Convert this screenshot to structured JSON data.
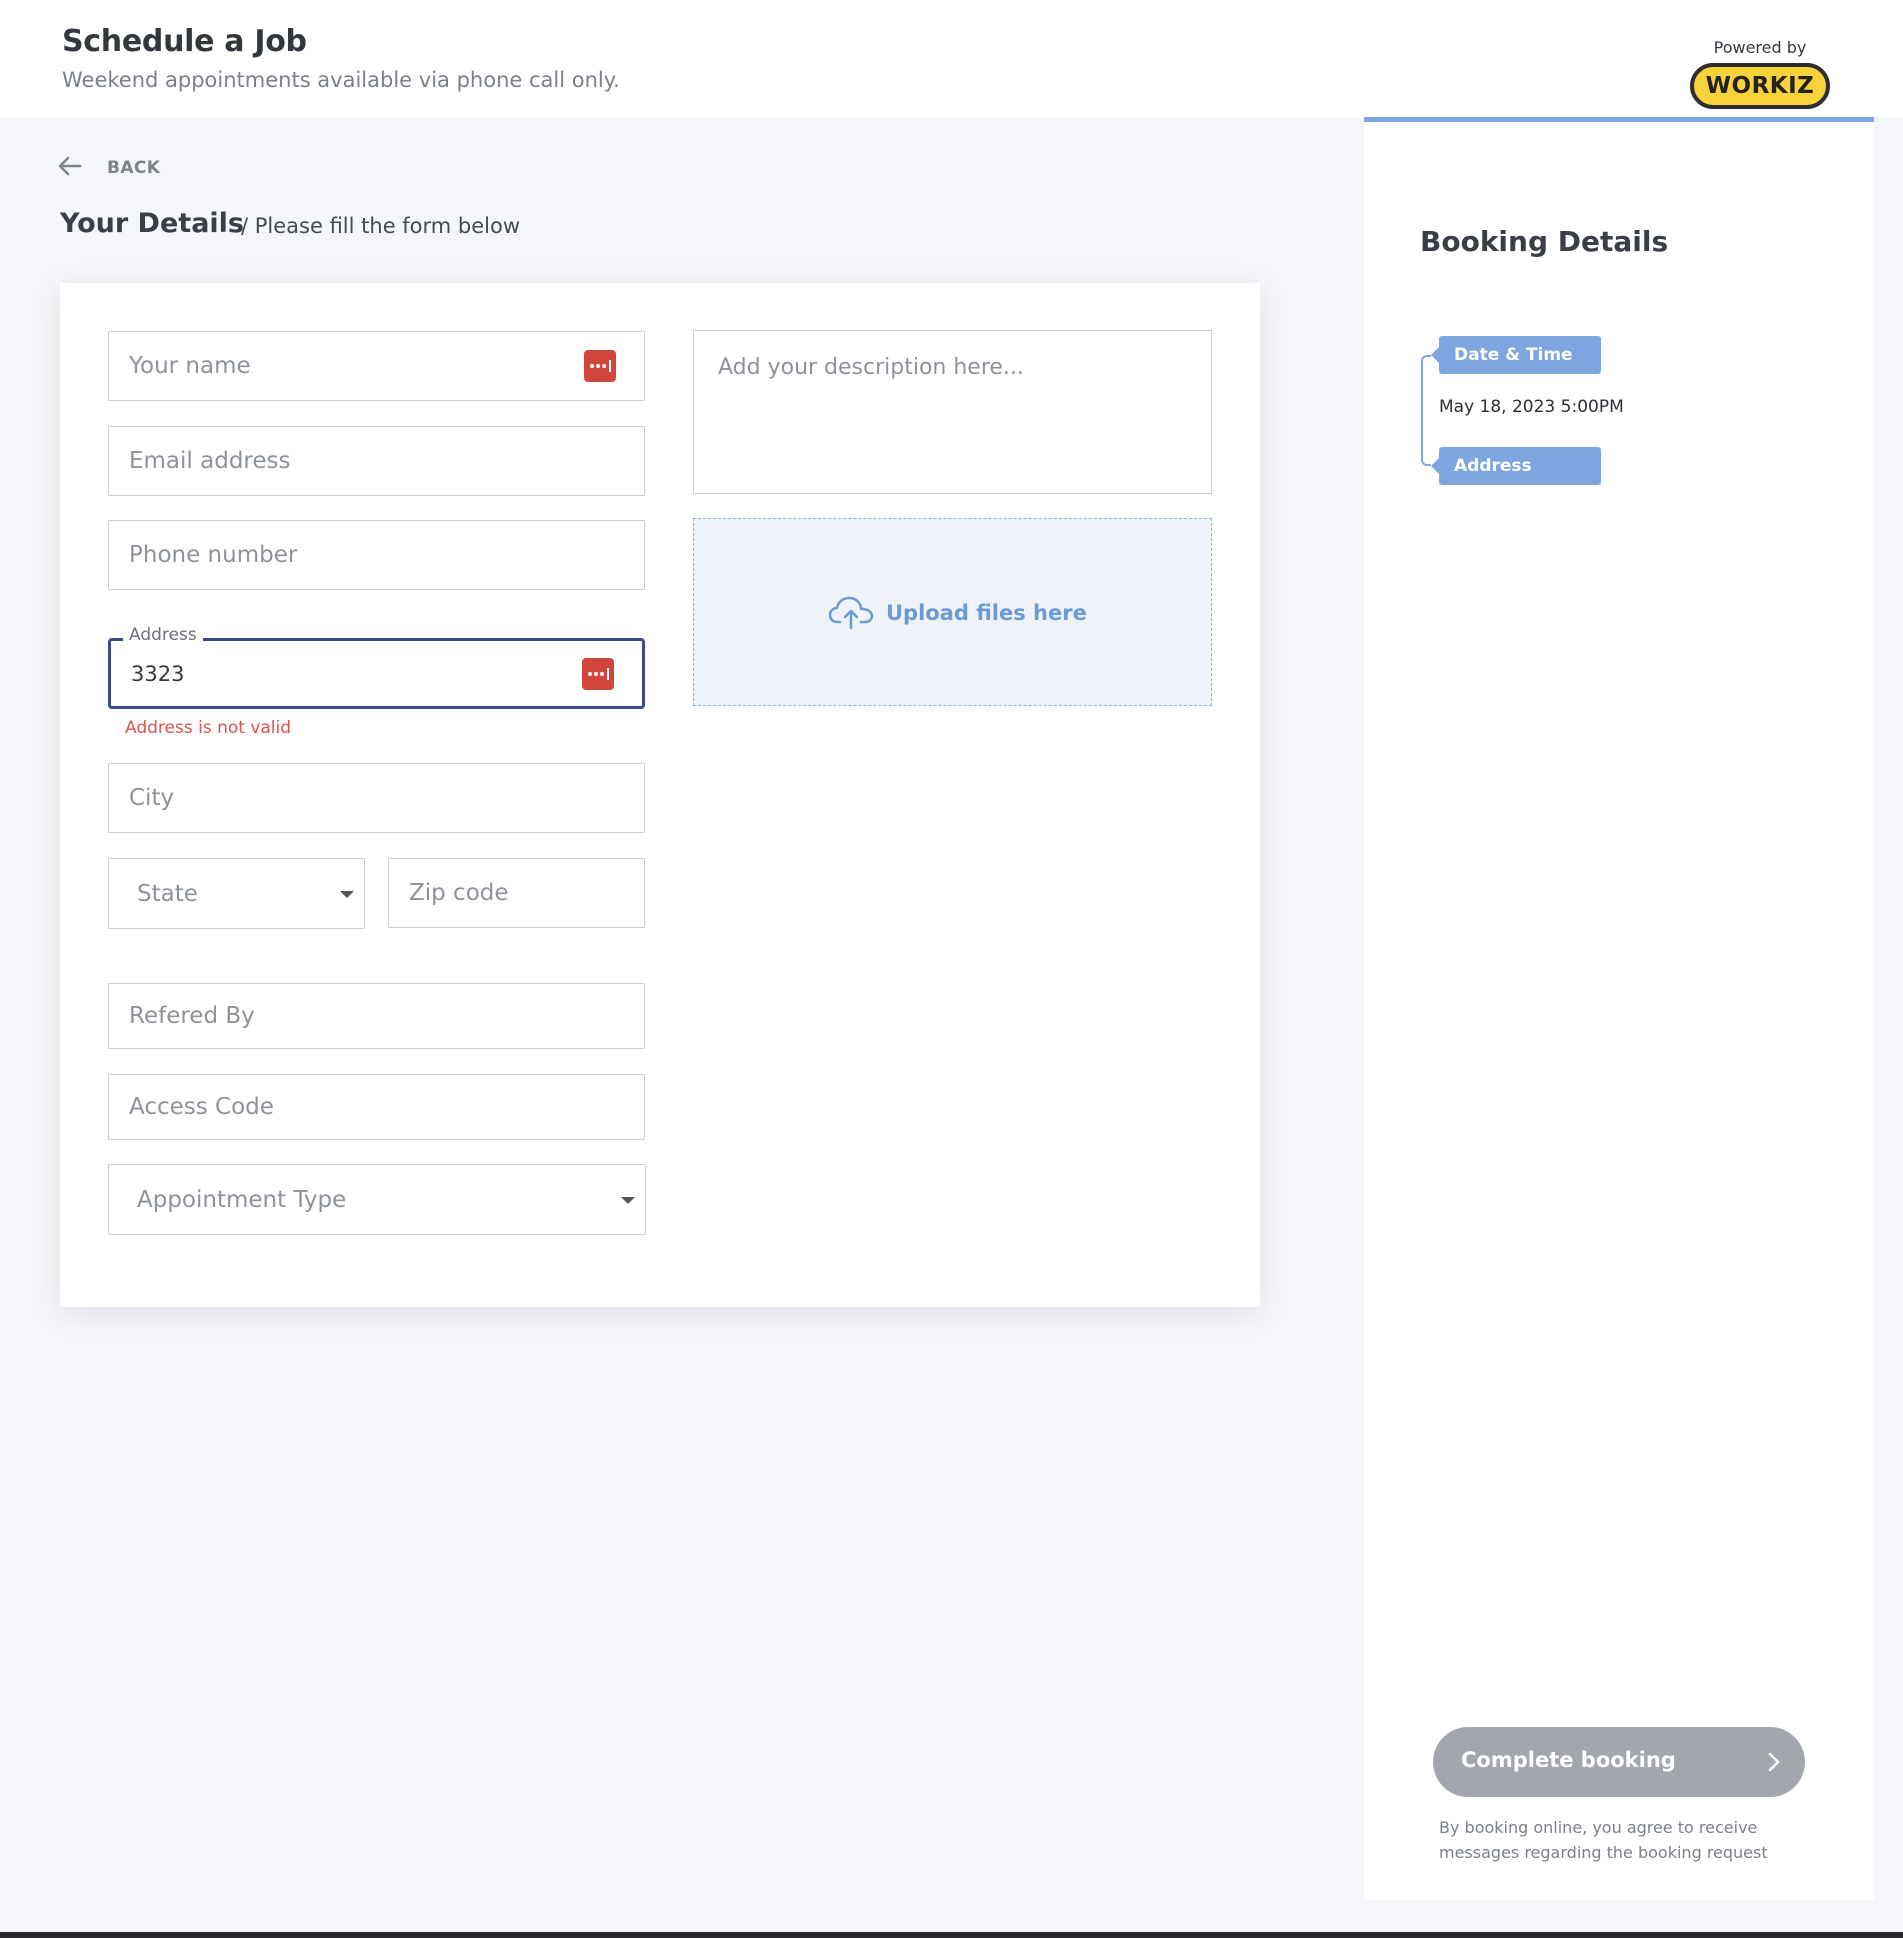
{
  "header": {
    "title": "Schedule a Job",
    "subtitle": "Weekend appointments available via phone call only.",
    "powered_by": "Powered by",
    "logo_text": "WORKIZ"
  },
  "nav": {
    "back_label": "BACK"
  },
  "section": {
    "title": "Your Details",
    "subtitle": "/ Please fill the form below"
  },
  "form": {
    "name_placeholder": "Your name",
    "email_placeholder": "Email address",
    "phone_placeholder": "Phone number",
    "address_label": "Address",
    "address_value": "3323",
    "address_error": "Address is not valid",
    "city_placeholder": "City",
    "state_placeholder": "State",
    "zip_placeholder": "Zip code",
    "referred_placeholder": "Refered By",
    "access_code_placeholder": "Access Code",
    "appointment_type_placeholder": "Appointment Type",
    "description_placeholder": "Add your description here...",
    "upload_label": "Upload files here"
  },
  "booking": {
    "title": "Booking Details",
    "date_time_label": "Date & Time",
    "date_time_value": "May 18, 2023 5:00PM",
    "address_label": "Address",
    "complete_label": "Complete booking",
    "terms": "By booking online, you agree to receive messages regarding the booking request"
  },
  "colors": {
    "accent": "#7ea5df",
    "error": "#d9534f",
    "focus": "#3b4a8d",
    "logo_yellow": "#f7d23a",
    "disabled_button": "#a3a7ad"
  },
  "icons": [
    "arrow-left-icon",
    "password-manager-icon",
    "chevron-down-icon",
    "cloud-upload-icon",
    "chevron-right-icon"
  ]
}
